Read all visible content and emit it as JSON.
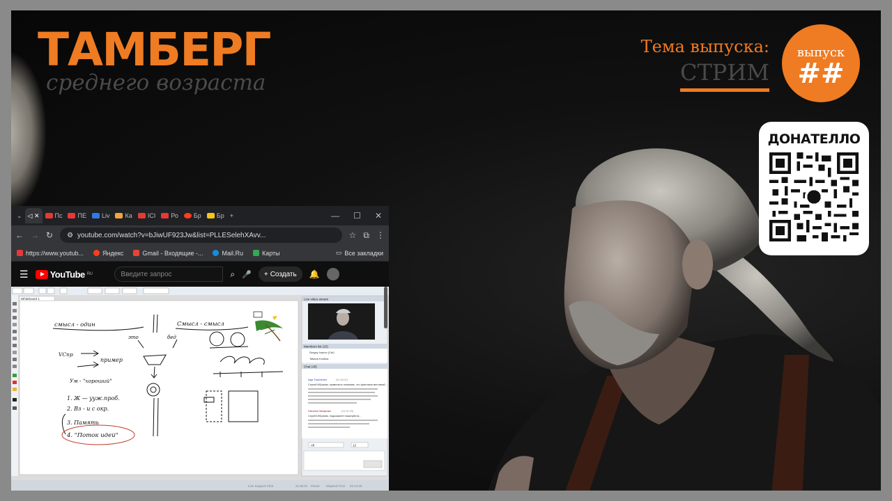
{
  "brand": {
    "title": "ТАМБЕРГ",
    "subtitle": "среднего возраста"
  },
  "theme": {
    "label": "Тема выпуска:",
    "value": "СТРИМ"
  },
  "episode": {
    "label": "выпуск",
    "number": "##"
  },
  "donate": {
    "title": "ДОНАТЕЛЛО"
  },
  "colors": {
    "accent": "#ef7b22",
    "background": "#0a0a0a"
  },
  "browser": {
    "tabs": [
      "Пс",
      "ПЕ",
      "Liv",
      "Ка",
      "ICI",
      "Ро",
      "Бр",
      "Бр"
    ],
    "url": "youtube.com/watch?v=bJiwUF923Jw&list=PLLESelehXAvv...",
    "bookmarks": [
      {
        "label": "https://www.youtub...",
        "icon": "youtube-icon"
      },
      {
        "label": "Яндекс",
        "icon": "yandex-icon"
      },
      {
        "label": "Gmail - Входящие -...",
        "icon": "gmail-icon"
      },
      {
        "label": "Mail.Ru",
        "icon": "mailru-icon"
      },
      {
        "label": "Карты",
        "icon": "maps-icon"
      }
    ],
    "all_bookmarks": "Все закладки"
  },
  "youtube": {
    "logo": "YouTube",
    "region": "RU",
    "search_placeholder": "Введите запрос",
    "create_label": "Создать"
  },
  "whiteboard": {
    "tab": "Whiteboard 1",
    "text_1": "смысл - один",
    "text_2": "Смысл - смысл",
    "text_3": "это",
    "text_4": "бед",
    "text_5": "VCпр",
    "text_6": "пример",
    "text_7": "Ум - \"хороший\"",
    "text_8": "1. Ж — ууж.проб.",
    "text_9": "2. Вз - и с окр.",
    "text_10": "3. Память",
    "text_11": "4. \"Поток идей\""
  },
  "side_panel": {
    "video_label": "Live video stream",
    "members_label": "Members list (15)",
    "member_1": "Sergey Ivanov (Ctrl)",
    "member_2": "Tatiana Kostina",
    "chat_label": "Chat (All)",
    "chat_1_name": "Inga Tkachenko",
    "chat_1_time": "(21:48:47)",
    "chat_1_text": "Сергей Ибрагим, правильно понимаю, что фантазия мечтаний...",
    "chat_2_name": "Наталья Захарова",
    "chat_2_time": "(21:51:20)",
    "chat_2_text": "Сергей Ибрагим, подскажите пожалуйста...",
    "filter": "All",
    "font_size": "12"
  },
  "taskbar": {
    "item_1": "Live Support Chat",
    "time": "21:56:01",
    "item_2": "Pause",
    "item_3": "Elapsed Time",
    "elapsed": "02:13:26"
  }
}
